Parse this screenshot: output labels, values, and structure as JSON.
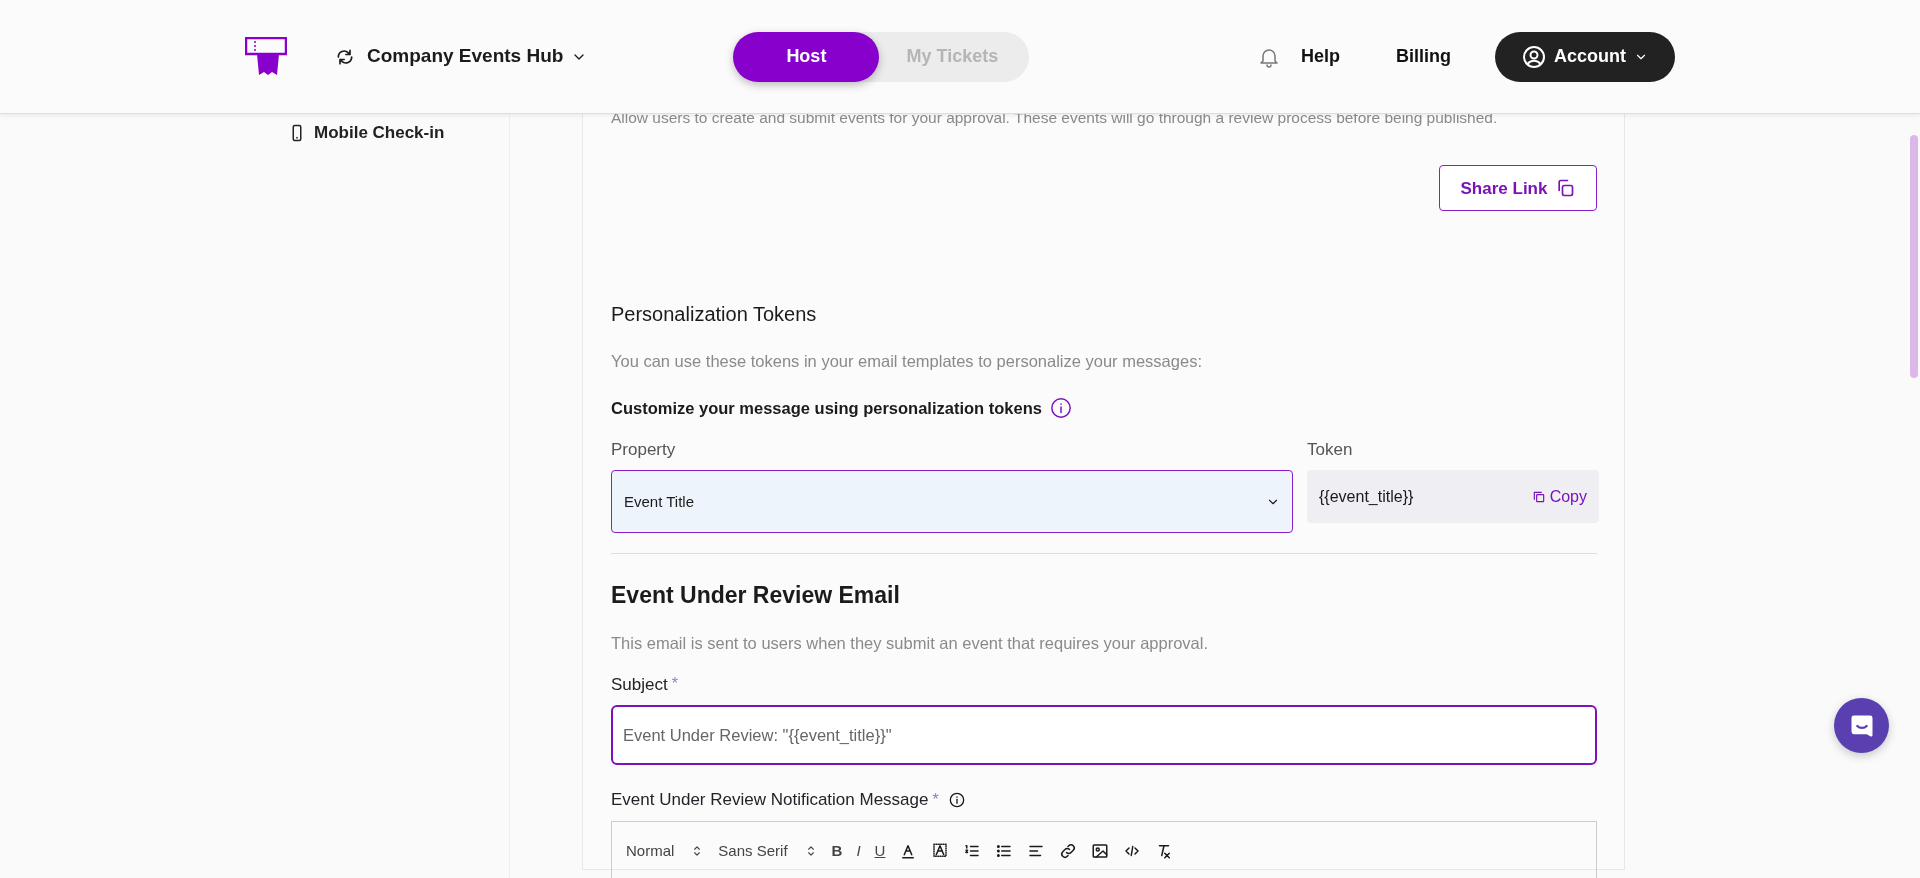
{
  "header": {
    "workspace": "Company Events Hub",
    "modes": [
      {
        "label": "Host",
        "selected": true
      },
      {
        "label": "My Tickets",
        "selected": false
      }
    ],
    "links": [
      "Help",
      "Billing"
    ],
    "account": "Account"
  },
  "sidebar": {
    "items": [
      {
        "label": "Mobile Check-in"
      }
    ]
  },
  "intro": "Allow users to create and submit events for your approval. These events will go through a review process before being published.",
  "share_button": "Share Link",
  "tokens": {
    "title": "Personalization Tokens",
    "description": "You can use these tokens in your email templates to personalize your messages:",
    "prompt": "Customize your message using personalization tokens",
    "property_label": "Property",
    "property_value": "Event Title",
    "token_label": "Token",
    "token_value": "{{event_title}}",
    "copy": "Copy"
  },
  "email": {
    "title": "Event Under Review Email",
    "description": "This email is sent to users when they submit an event that requires your approval.",
    "subject": {
      "label": "Subject",
      "required_mark": "*",
      "value": "Event Under Review: \"{{event_title}}\""
    },
    "message": {
      "label": "Event Under Review Notification Message",
      "required_mark": "*"
    },
    "toolbar": [
      {
        "kind": "select",
        "label": "Normal"
      },
      {
        "kind": "select",
        "label": "Sans Serif"
      },
      {
        "kind": "bold",
        "label": "B"
      },
      {
        "kind": "italic",
        "label": "I"
      },
      {
        "kind": "underline",
        "label": "U"
      },
      {
        "kind": "color"
      },
      {
        "kind": "background"
      },
      {
        "kind": "ordered"
      },
      {
        "kind": "bullet"
      },
      {
        "kind": "align"
      },
      {
        "kind": "link"
      },
      {
        "kind": "image"
      },
      {
        "kind": "code"
      },
      {
        "kind": "clean"
      }
    ]
  }
}
